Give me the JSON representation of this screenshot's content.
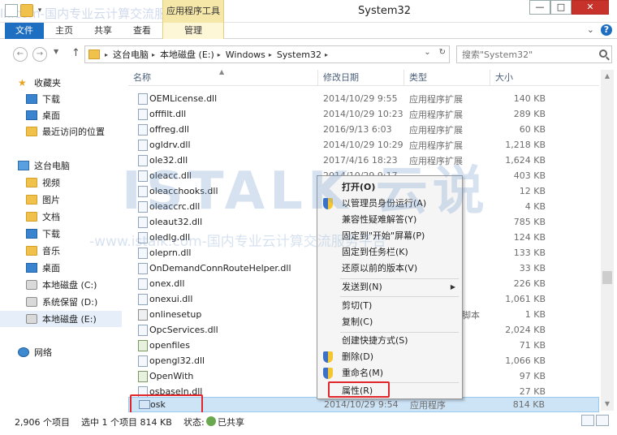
{
  "window": {
    "title": "System32",
    "context_tab_group": "应用程序工具",
    "close_symbol": "✕",
    "max_symbol": "□",
    "min_symbol": "—"
  },
  "ribbon": {
    "file_tab": "文件",
    "tabs": [
      "主页",
      "共享",
      "查看"
    ],
    "context_tab": "管理",
    "help": "?"
  },
  "address": {
    "crumbs": [
      "这台电脑",
      "本地磁盘 (E:)",
      "Windows",
      "System32"
    ],
    "search_placeholder": "搜索\"System32\""
  },
  "sidebar": {
    "favorites_header": "收藏夹",
    "favorites": [
      "下载",
      "桌面",
      "最近访问的位置"
    ],
    "pc_header": "这台电脑",
    "pc_items": [
      "视频",
      "图片",
      "文档",
      "下载",
      "音乐",
      "桌面",
      "本地磁盘 (C:)",
      "系统保留 (D:)",
      "本地磁盘 (E:)"
    ],
    "network": "网络"
  },
  "columns": {
    "name": "名称",
    "date": "修改日期",
    "type": "类型",
    "size": "大小"
  },
  "files": [
    {
      "name": "OEMLicense.dll",
      "date": "2014/10/29 9:55",
      "type": "应用程序扩展",
      "size": "140 KB"
    },
    {
      "name": "offfilt.dll",
      "date": "2014/10/29 10:23",
      "type": "应用程序扩展",
      "size": "289 KB"
    },
    {
      "name": "offreg.dll",
      "date": "2016/9/13 6:03",
      "type": "应用程序扩展",
      "size": "60 KB"
    },
    {
      "name": "ogldrv.dll",
      "date": "2014/10/29 10:29",
      "type": "应用程序扩展",
      "size": "1,218 KB"
    },
    {
      "name": "ole32.dll",
      "date": "2017/4/16 18:23",
      "type": "应用程序扩展",
      "size": "1,624 KB"
    },
    {
      "name": "oleacc.dll",
      "date": "2014/10/29 9:17",
      "type": "",
      "size": "403 KB"
    },
    {
      "name": "oleacchooks.dll",
      "date": "",
      "type": "",
      "size": "12 KB"
    },
    {
      "name": "oleaccrc.dll",
      "date": "",
      "type": "",
      "size": "4 KB"
    },
    {
      "name": "oleaut32.dll",
      "date": "",
      "type": "",
      "size": "785 KB"
    },
    {
      "name": "oledlg.dll",
      "date": "",
      "type": "",
      "size": "124 KB"
    },
    {
      "name": "oleprn.dll",
      "date": "",
      "type": "",
      "size": "133 KB"
    },
    {
      "name": "OnDemandConnRouteHelper.dll",
      "date": "",
      "type": "",
      "size": "33 KB"
    },
    {
      "name": "onex.dll",
      "date": "",
      "type": "",
      "size": "226 KB"
    },
    {
      "name": "onexui.dll",
      "date": "",
      "type": "",
      "size": "1,061 KB"
    },
    {
      "name": "onlinesetup",
      "date": "",
      "type": "令脚本",
      "size": "1 KB"
    },
    {
      "name": "OpcServices.dll",
      "date": "",
      "type": "",
      "size": "2,024 KB"
    },
    {
      "name": "openfiles",
      "date": "",
      "type": "",
      "size": "71 KB"
    },
    {
      "name": "opengl32.dll",
      "date": "",
      "type": "",
      "size": "1,066 KB"
    },
    {
      "name": "OpenWith",
      "date": "",
      "type": "",
      "size": "97 KB"
    },
    {
      "name": "osbaseln.dll",
      "date": "",
      "type": "",
      "size": "27 KB"
    },
    {
      "name": "osk",
      "date": "2014/10/29 9:54",
      "type": "应用程序",
      "size": "814 KB"
    }
  ],
  "context_menu": {
    "open": "打开(O)",
    "run_as_admin": "以管理员身份运行(A)",
    "troubleshoot": "兼容性疑难解答(Y)",
    "pin_start": "固定到\"开始\"屏幕(P)",
    "pin_taskbar": "固定到任务栏(K)",
    "restore": "还原以前的版本(V)",
    "send_to": "发送到(N)",
    "cut": "剪切(T)",
    "copy": "复制(C)",
    "shortcut": "创建快捷方式(S)",
    "delete": "删除(D)",
    "rename": "重命名(M)",
    "properties": "属性(R)"
  },
  "status": {
    "count": "2,906 个项目",
    "selection": "选中 1 个项目  814 KB",
    "state": "状态:",
    "shared": "已共享"
  },
  "watermarks": {
    "top": "lk.com-国内专业云计算交流服务平台",
    "middle": "-www.istalk.com-国内专业云计算交流服务平台",
    "logo": "ISTALK 云说"
  },
  "colors": {
    "accent": "#1e6fc1",
    "highlight": "#e0262a",
    "selected_row": "#cde4f7"
  }
}
